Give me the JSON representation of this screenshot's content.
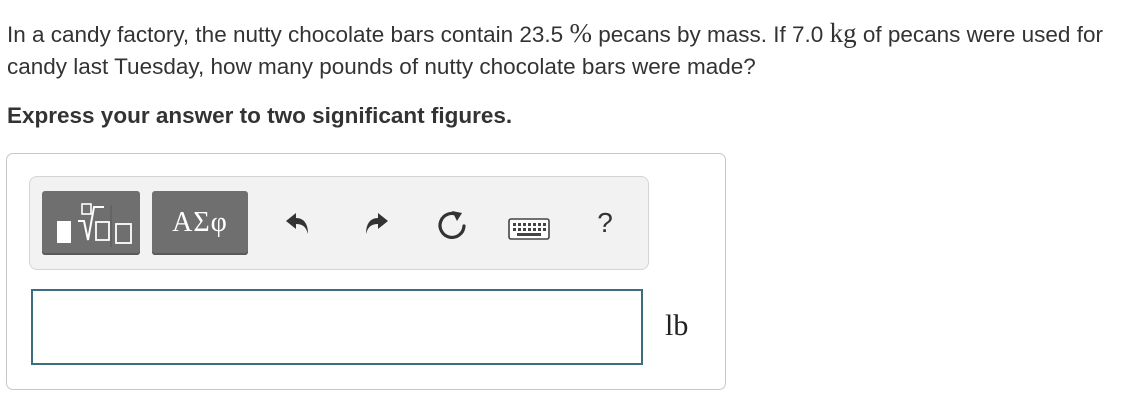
{
  "question": {
    "part1": "In a candy factory, the nutty chocolate bars contain 23.5 ",
    "percent_symbol": "%",
    "part2": " pecans by mass. If 7.0 ",
    "kg_unit": "kg",
    "part3": " of pecans were used for candy last Tuesday, how many pounds of nutty chocolate bars were made?"
  },
  "instruction": "Express your answer to two significant figures.",
  "toolbar": {
    "templates_icon": "templates-icon",
    "greek_label": "ΑΣφ",
    "undo_icon": "undo-icon",
    "redo_icon": "redo-icon",
    "reset_icon": "reset-icon",
    "keyboard_icon": "keyboard-icon",
    "help_label": "?"
  },
  "answer": {
    "value": "",
    "unit": "lb"
  },
  "colors": {
    "toolbar_button": "#6f6f6f",
    "input_border": "#3c6e80",
    "toolbar_bg": "#f2f2f2"
  }
}
